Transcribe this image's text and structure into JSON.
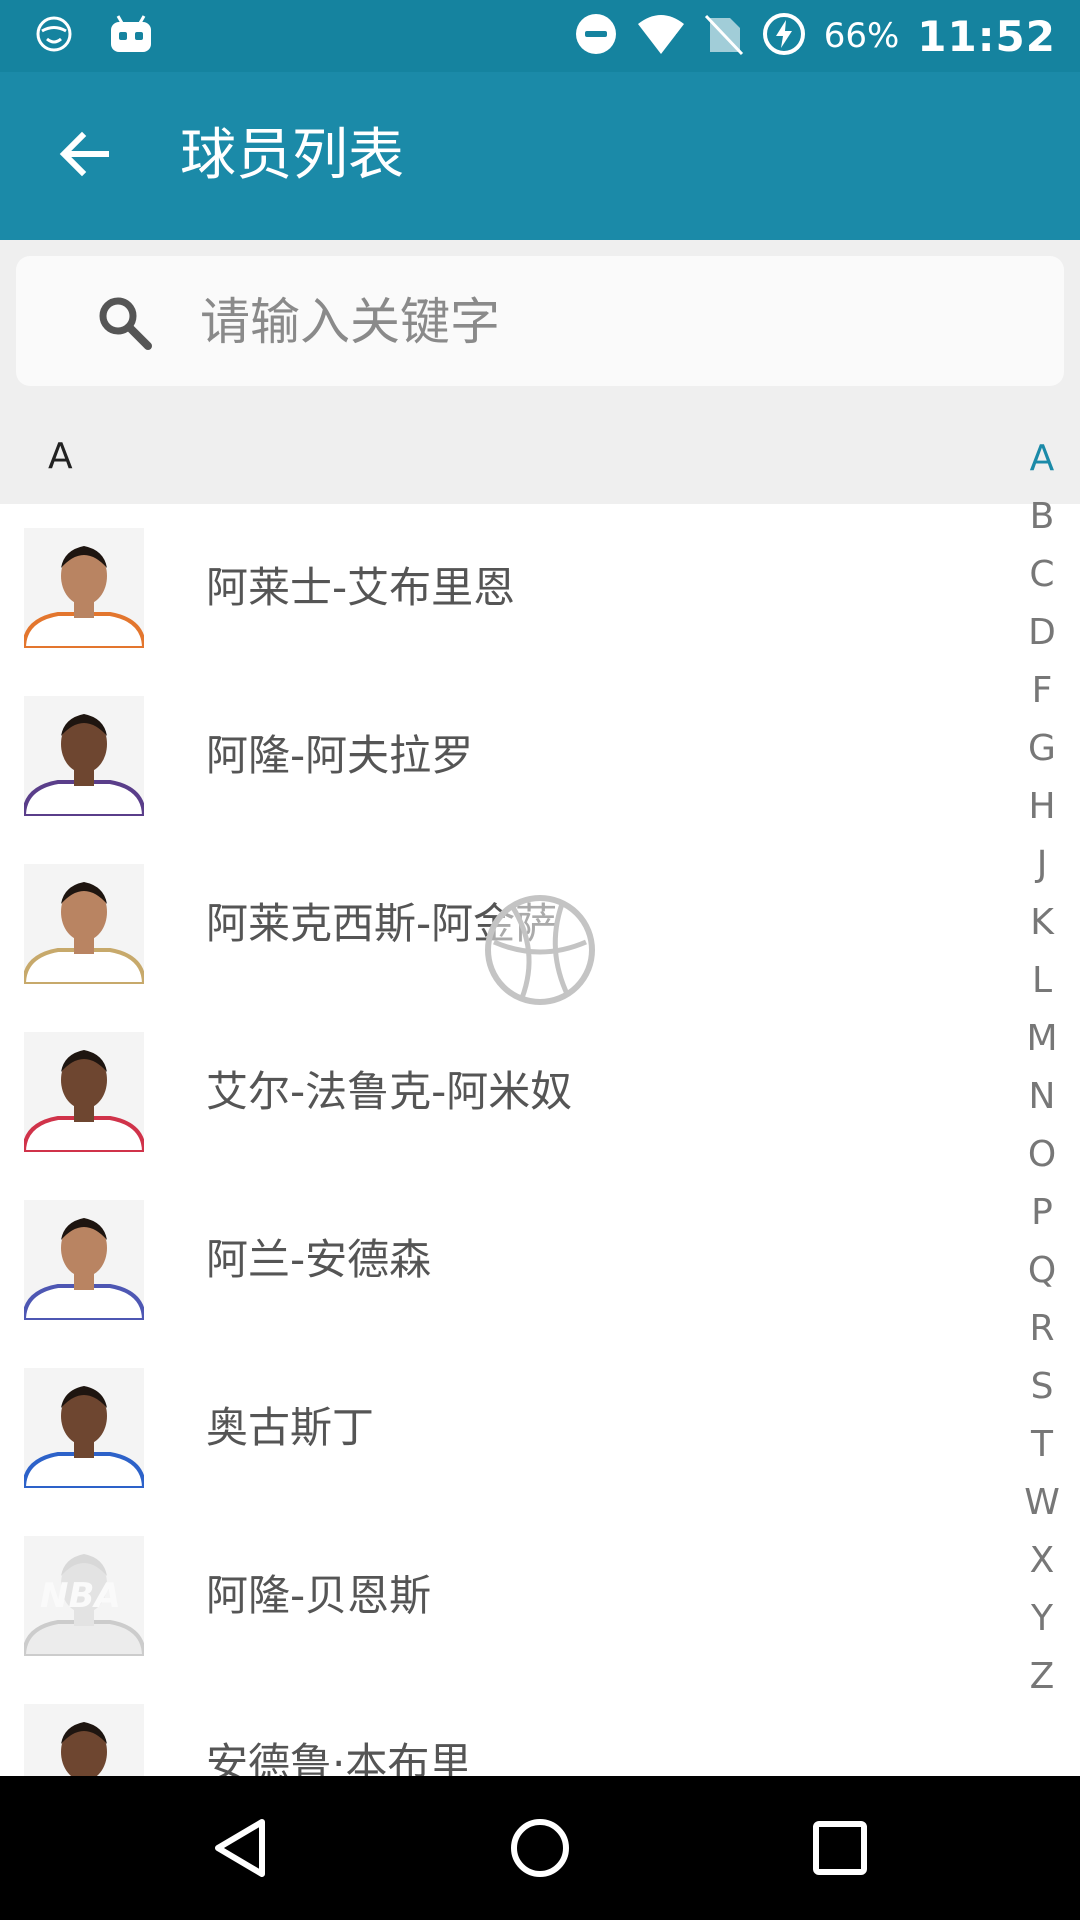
{
  "status_bar": {
    "battery": "66%",
    "time": "11:52",
    "icons": [
      "smiley-icon",
      "android-icon",
      "dnd-icon",
      "wifi-icon",
      "no-sim-icon",
      "charging-icon"
    ]
  },
  "app_bar": {
    "title": "球员列表",
    "back_icon": "arrow-left-icon"
  },
  "search": {
    "placeholder": "请输入关键字",
    "value": ""
  },
  "section": {
    "letter": "A"
  },
  "players": [
    {
      "name": "阿莱士-艾布里恩",
      "jersey": "#e3762e"
    },
    {
      "name": "阿隆-阿夫拉罗",
      "jersey": "#5a3e8a"
    },
    {
      "name": "阿莱克西斯-阿金萨",
      "jersey": "#c7a96b"
    },
    {
      "name": "艾尔-法鲁克-阿米奴",
      "jersey": "#d0334a"
    },
    {
      "name": "阿兰-安德森",
      "jersey": "#4e57b3"
    },
    {
      "name": "奥古斯丁",
      "jersey": "#2d62c9"
    },
    {
      "name": "阿隆-贝恩斯",
      "jersey": "#cccccc",
      "placeholder_text": "NBA"
    },
    {
      "name": "安德鲁·本布里",
      "jersey": "#aaaaaa"
    }
  ],
  "index_letters": [
    "A",
    "B",
    "C",
    "D",
    "F",
    "G",
    "H",
    "J",
    "K",
    "L",
    "M",
    "N",
    "O",
    "P",
    "Q",
    "R",
    "S",
    "T",
    "W",
    "X",
    "Y",
    "Z"
  ],
  "index_active": "A",
  "colors": {
    "status_bar": "#15839f",
    "app_bar": "#1b8aa8",
    "accent": "#1b8aa8"
  },
  "nav_bar": {
    "icons": [
      "back-triangle-icon",
      "home-circle-icon",
      "recents-square-icon"
    ]
  }
}
